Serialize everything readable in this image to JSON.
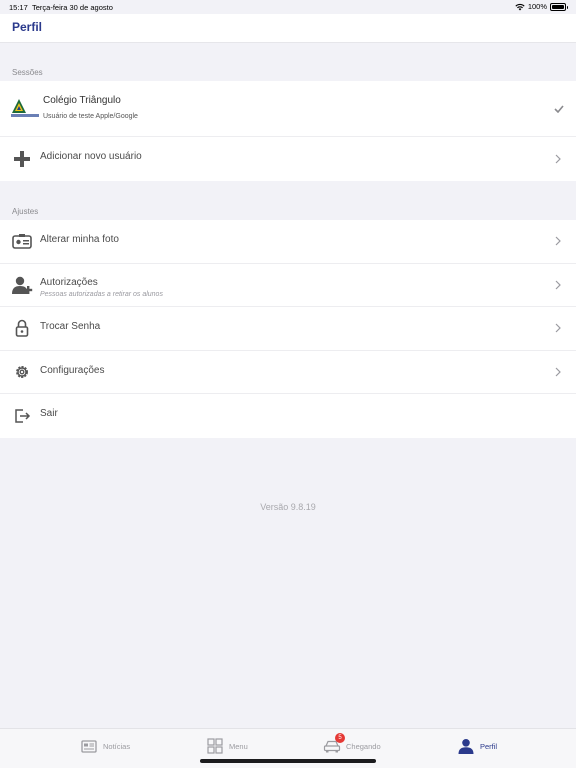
{
  "status": {
    "time": "15:17",
    "date": "Terça-feira 30 de agosto",
    "battery": "100%"
  },
  "nav": {
    "title": "Perfil"
  },
  "sessions": {
    "header": "Sessões",
    "items": [
      {
        "title": "Colégio Triângulo",
        "subtitle": "Usuário de teste Apple/Google",
        "icon": "school-logo-icon",
        "selected": true
      },
      {
        "title": "Adicionar novo usuário",
        "icon": "plus-icon"
      }
    ]
  },
  "settings": {
    "header": "Ajustes",
    "items": [
      {
        "title": "Alterar minha foto",
        "icon": "id-card-icon"
      },
      {
        "title": "Autorizações",
        "subtitle": "Pessoas autorizadas a retirar os alunos",
        "icon": "add-person-icon"
      },
      {
        "title": "Trocar Senha",
        "icon": "lock-icon"
      },
      {
        "title": "Configurações",
        "icon": "gear-icon"
      },
      {
        "title": "Sair",
        "icon": "logout-icon"
      }
    ]
  },
  "version": "Versão 9.8.19",
  "tabs": [
    {
      "label": "Notícias",
      "icon": "newspaper-icon"
    },
    {
      "label": "Menu",
      "icon": "grid-icon"
    },
    {
      "label": "Chegando",
      "icon": "car-icon",
      "badge": "5"
    },
    {
      "label": "Perfil",
      "icon": "person-icon",
      "active": true
    }
  ],
  "colors": {
    "accent": "#2b3a8c",
    "badge": "#e53935",
    "background": "#f2f2f7"
  }
}
